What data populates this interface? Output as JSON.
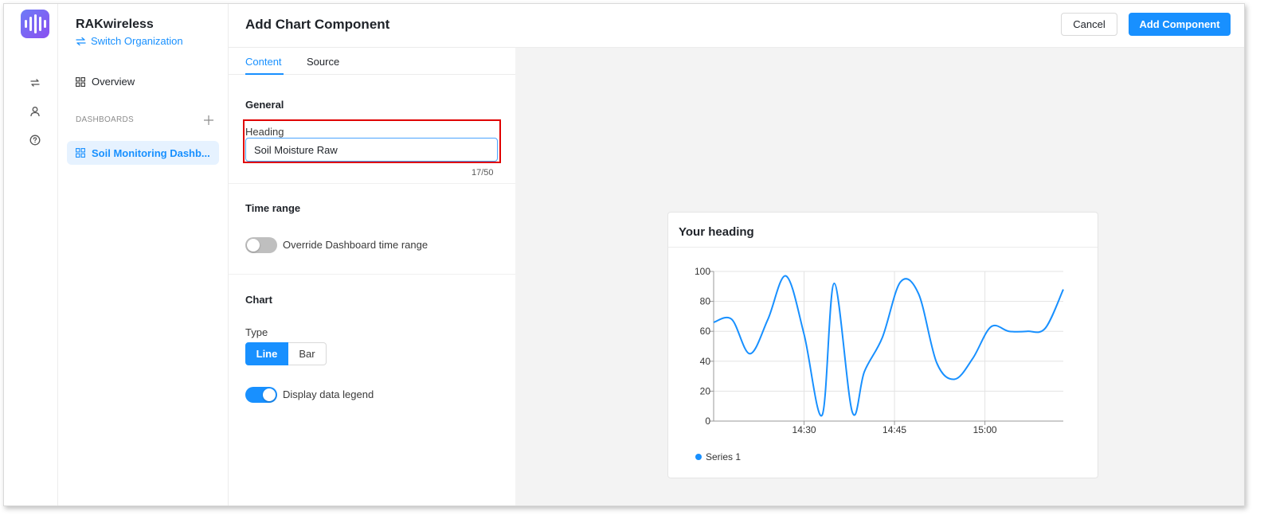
{
  "app": {
    "org_name": "RAKwireless",
    "switch_org_label": "Switch Organization"
  },
  "rail": {
    "icons": [
      "swap-icon",
      "user-icon",
      "help-icon"
    ]
  },
  "sidebar": {
    "overview_label": "Overview",
    "dashboards_title": "DASHBOARDS",
    "items": [
      {
        "label": "Soil Monitoring Dashb..."
      }
    ]
  },
  "header": {
    "title": "Add Chart Component",
    "cancel_label": "Cancel",
    "add_label": "Add Component"
  },
  "tabs": [
    {
      "label": "Content",
      "active": true
    },
    {
      "label": "Source",
      "active": false
    }
  ],
  "form": {
    "general_title": "General",
    "heading_label": "Heading",
    "heading_value": "Soil Moisture Raw",
    "heading_counter": "17/50",
    "time_range_title": "Time range",
    "override_label": "Override Dashboard time range",
    "override_on": false,
    "chart_title": "Chart",
    "type_label": "Type",
    "type_options": [
      "Line",
      "Bar"
    ],
    "type_selected": "Line",
    "legend_label": "Display data legend",
    "legend_on": true
  },
  "preview": {
    "card_heading": "Your heading"
  },
  "colors": {
    "accent": "#1890ff",
    "highlight": "#e00000"
  },
  "chart_data": {
    "type": "line",
    "title": "Your heading",
    "xlabel": "",
    "ylabel": "",
    "ylim": [
      0,
      100
    ],
    "yticks": [
      "0",
      "20",
      "40",
      "60",
      "80",
      "100"
    ],
    "xticks": [
      {
        "x": 22,
        "label": "14:30"
      },
      {
        "x": 37,
        "label": "14:45"
      },
      {
        "x": 52,
        "label": "15:00"
      }
    ],
    "xlim": [
      7,
      65
    ],
    "grid": true,
    "legend_position": "bottom-left",
    "series": [
      {
        "name": "Series 1",
        "color": "#1890ff",
        "x": [
          7,
          10,
          13,
          16,
          19,
          22,
          25,
          27,
          30,
          32,
          35,
          38,
          41,
          44,
          47,
          50,
          53,
          56,
          59,
          62,
          65
        ],
        "y": [
          66,
          68,
          45,
          68,
          97,
          58,
          4,
          92,
          6,
          33,
          56,
          93,
          85,
          39,
          28,
          42,
          63,
          60,
          60,
          62,
          88
        ]
      }
    ]
  }
}
